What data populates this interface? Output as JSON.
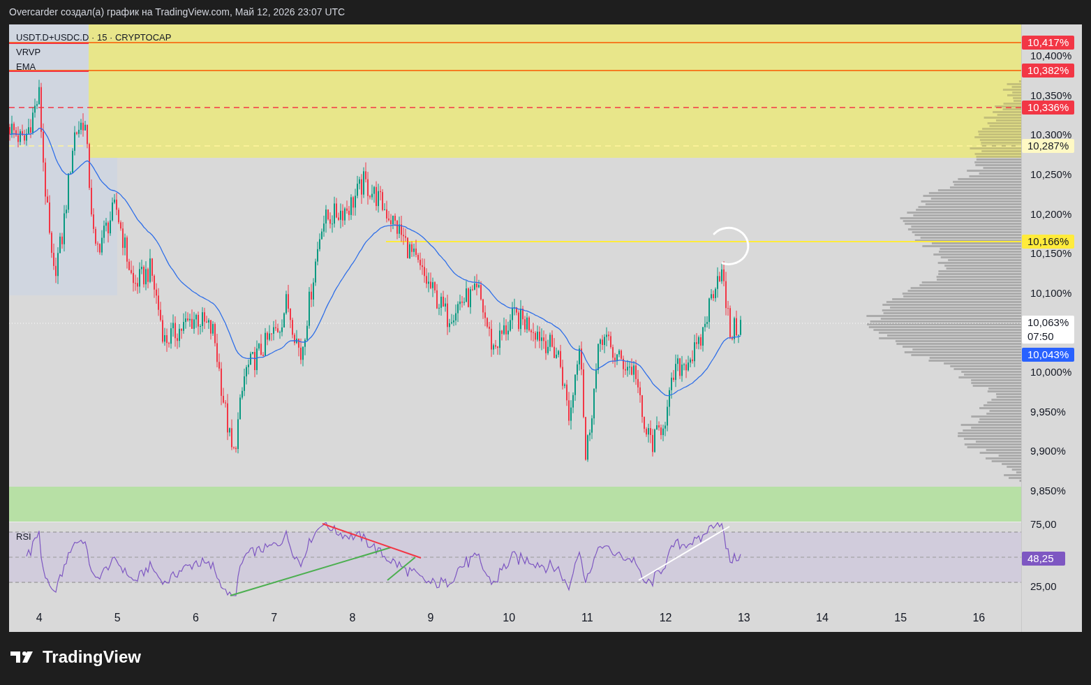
{
  "header": {
    "text": "Overcarder создал(а) график на TradingView.com, Май 12, 2026 23:07 UTC"
  },
  "legend": {
    "symbol": "USDT.D+USDC.D · 15 · CRYPTOCAP",
    "indicators": [
      "VRVP",
      "EMA"
    ]
  },
  "price_axis": {
    "ticks": [
      "10,400%",
      "10,350%",
      "10,300%",
      "10,250%",
      "10,200%",
      "10,150%",
      "10,100%",
      "10,000%",
      "9,950%",
      "9,900%",
      "9,850%"
    ]
  },
  "price_tags": [
    {
      "label": "10,417%",
      "color": "#f23645"
    },
    {
      "label": "10,382%",
      "color": "#f23645"
    },
    {
      "label": "10,336%",
      "color": "#f23645"
    },
    {
      "label": "10,287%",
      "color": "#fff9c4"
    },
    {
      "label": "10,166%",
      "color": "#ffeb3b"
    },
    {
      "label": "10,063%",
      "sublabel": "07:50",
      "color": "#ffffff"
    },
    {
      "label": "10,043%",
      "color": "#2962ff"
    }
  ],
  "rsi_pane": {
    "label": "RSI",
    "ticks": [
      "75,00",
      "25,00"
    ],
    "value_tag": {
      "label": "48,25",
      "color": "#7e57c2"
    }
  },
  "time_axis": {
    "ticks": [
      "4",
      "5",
      "6",
      "7",
      "8",
      "9",
      "10",
      "11",
      "12",
      "13",
      "14",
      "15",
      "16"
    ]
  },
  "footer": {
    "brand": "TradingView"
  }
}
